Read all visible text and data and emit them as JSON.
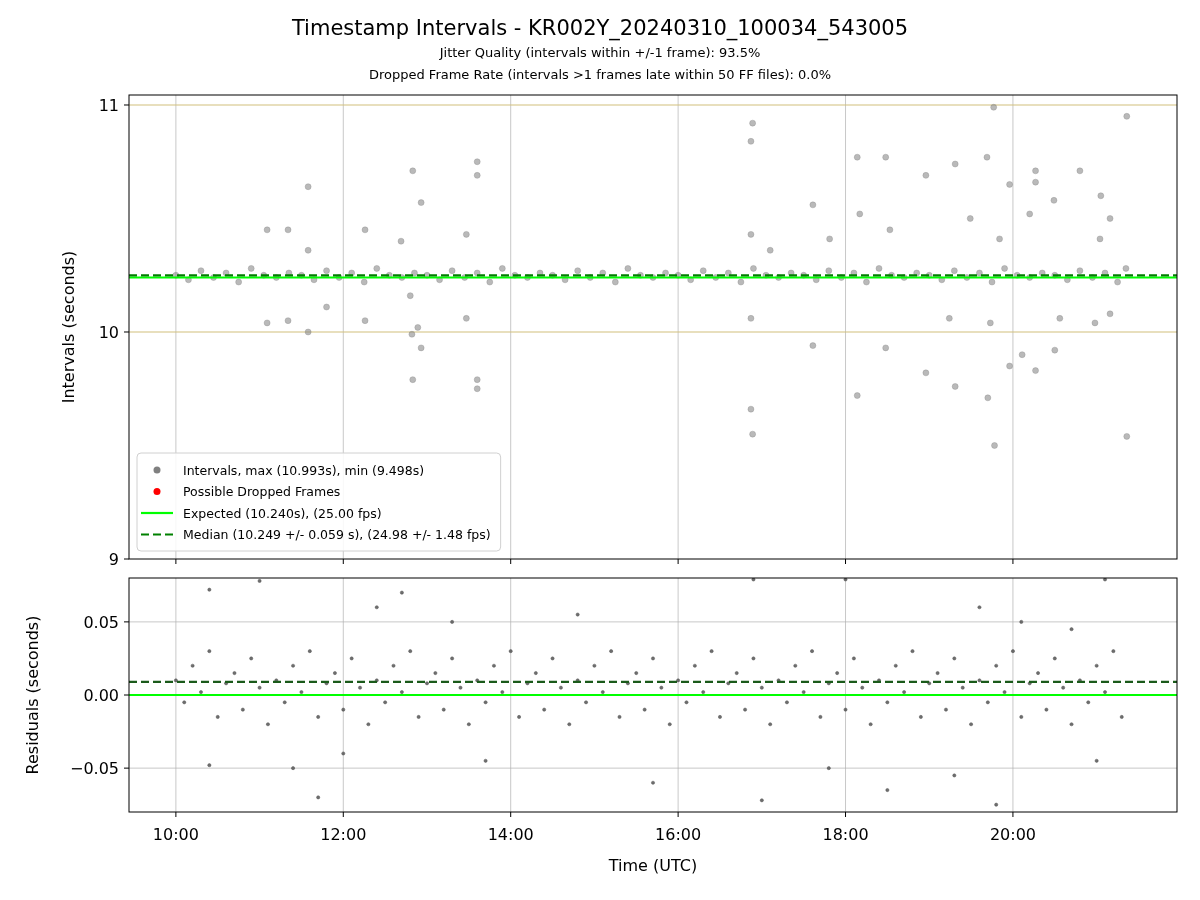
{
  "figure": {
    "title": "Timestamp Intervals - KR002Y_20240310_100034_543005",
    "subtitle_lines": [
      "Jitter Quality (intervals within +/-1 frame): 93.5%",
      "Dropped Frame Rate (intervals >1 frames late within 50 FF files): 0.0%"
    ]
  },
  "intervals_plot": {
    "chart_data": {
      "type": "scatter",
      "ylabel": "Intervals (seconds)",
      "xlim": [
        9.44,
        21.96
      ],
      "ylim": [
        9,
        11.044
      ],
      "yticks": [
        {
          "value": 9,
          "label": "9"
        },
        {
          "value": 10,
          "label": "10"
        },
        {
          "value": 11,
          "label": "11"
        }
      ],
      "ref_lines": [
        {
          "axis": "y",
          "value": 10
        },
        {
          "axis": "y",
          "value": 11
        }
      ],
      "grid": "x",
      "legend": true,
      "series": [
        {
          "name": "Intervals, max (10.993s), min (9.498s)",
          "color": "#808080",
          "x": [
            10,
            10.15,
            10.3,
            10.45,
            10.6,
            10.75,
            10.9,
            11.05,
            11.2,
            11.35,
            11.5,
            11.65,
            11.8,
            11.95,
            12.1,
            12.25,
            12.4,
            12.55,
            12.7,
            12.85,
            13,
            13.15,
            13.3,
            13.45,
            13.6,
            13.75,
            13.9,
            14.05,
            14.2,
            14.35,
            14.5,
            14.65,
            14.8,
            14.95,
            15.1,
            15.25,
            15.4,
            15.55,
            15.7,
            15.85,
            16,
            16.15,
            16.3,
            16.45,
            16.6,
            16.75,
            16.9,
            17.05,
            17.2,
            17.35,
            17.5,
            17.65,
            17.8,
            17.95,
            18.1,
            18.25,
            18.4,
            18.55,
            18.7,
            18.85,
            19,
            19.15,
            19.3,
            19.45,
            19.6,
            19.75,
            19.9,
            20.05,
            20.2,
            20.35,
            20.5,
            20.65,
            20.8,
            20.95,
            21.1,
            21.25,
            21.35,
            11.09,
            11.09,
            11.34,
            11.34,
            11.58,
            11.58,
            11.58,
            11.8,
            12.26,
            12.26,
            12.69,
            12.8,
            12.83,
            12.82,
            12.83,
            12.89,
            12.93,
            12.93,
            13.6,
            13.6,
            13.6,
            13.6,
            13.47,
            13.47,
            16.87,
            16.89,
            16.87,
            16.87,
            16.87,
            16.89,
            17.61,
            17.61,
            18.14,
            18.14,
            18.48,
            18.48,
            18.96,
            18.96,
            19.31,
            19.31,
            19.69,
            19.7,
            19.77,
            19.78,
            19.96,
            19.96,
            20.27,
            20.27,
            20.27,
            20.49,
            20.8,
            21.05,
            21.36,
            21.36,
            20.5,
            20.11,
            20.2,
            19.49,
            19.84,
            21.04,
            21.16,
            18.53,
            18.17,
            17.81,
            17.1,
            19.24,
            19.73,
            20.56,
            20.98,
            21.16
          ],
          "values": [
            10.25,
            10.23,
            10.27,
            10.24,
            10.26,
            10.22,
            10.28,
            10.25,
            10.24,
            10.26,
            10.25,
            10.23,
            10.27,
            10.24,
            10.26,
            10.22,
            10.28,
            10.25,
            10.24,
            10.26,
            10.25,
            10.23,
            10.27,
            10.24,
            10.26,
            10.22,
            10.28,
            10.25,
            10.24,
            10.26,
            10.25,
            10.23,
            10.27,
            10.24,
            10.26,
            10.22,
            10.28,
            10.25,
            10.24,
            10.26,
            10.25,
            10.23,
            10.27,
            10.24,
            10.26,
            10.22,
            10.28,
            10.25,
            10.24,
            10.26,
            10.25,
            10.23,
            10.27,
            10.24,
            10.26,
            10.22,
            10.28,
            10.25,
            10.24,
            10.26,
            10.25,
            10.23,
            10.27,
            10.24,
            10.26,
            10.22,
            10.28,
            10.25,
            10.24,
            10.26,
            10.25,
            10.23,
            10.27,
            10.24,
            10.26,
            10.22,
            10.28,
            10.45,
            10.04,
            10.45,
            10.05,
            10.64,
            10.36,
            10.0,
            10.11,
            10.45,
            10.05,
            10.4,
            10.16,
            10.71,
            9.99,
            9.79,
            10.02,
            9.93,
            10.57,
            10.75,
            10.69,
            9.79,
            9.75,
            10.06,
            10.43,
            10.84,
            10.92,
            10.43,
            10.06,
            9.66,
            9.55,
            10.56,
            9.94,
            10.77,
            9.72,
            10.77,
            9.93,
            10.69,
            9.82,
            10.74,
            9.76,
            10.77,
            9.71,
            10.99,
            9.5,
            10.65,
            9.85,
            10.71,
            10.66,
            9.83,
            10.58,
            10.71,
            10.6,
            10.95,
            9.54,
            9.92,
            9.9,
            10.52,
            10.5,
            10.41,
            10.41,
            10.5,
            10.45,
            10.52,
            10.41,
            10.36,
            10.06,
            10.04,
            10.06,
            10.04,
            10.08
          ]
        },
        {
          "name": "Possible Dropped Frames",
          "color": "#ff0000"
        },
        {
          "name": "Expected (10.240s), (25.00 fps)",
          "type": "line",
          "color": "#00ff00",
          "x": [
            9.44,
            21.96
          ],
          "values": [
            10.24,
            10.24
          ]
        },
        {
          "name": "Median (10.249 +/- 0.059 s), (24.98 +/- 1.48 fps)",
          "type": "line",
          "line_style": "dashed",
          "color": "#008000",
          "x": [
            9.44,
            21.96
          ],
          "values": [
            10.249,
            10.249
          ]
        }
      ]
    }
  },
  "residuals_plot": {
    "chart_data": {
      "type": "scatter",
      "xlabel": "Time (UTC)",
      "ylabel": "Residuals (seconds)",
      "grid": "both",
      "xlim": [
        9.44,
        21.96
      ],
      "ylim": [
        -0.08,
        0.08
      ],
      "xticks": [
        {
          "value": 10,
          "label": "10:00"
        },
        {
          "value": 12,
          "label": "12:00"
        },
        {
          "value": 14,
          "label": "14:00"
        },
        {
          "value": 16,
          "label": "16:00"
        },
        {
          "value": 18,
          "label": "18:00"
        },
        {
          "value": 20,
          "label": "20:00"
        }
      ],
      "yticks": [
        {
          "value": -0.05,
          "label": "−0.05"
        },
        {
          "value": 0,
          "label": "0.00"
        },
        {
          "value": 0.05,
          "label": "0.05"
        }
      ],
      "series": [
        {
          "color": "#555555",
          "x": [
            10,
            10.1,
            10.2,
            10.3,
            10.4,
            10.5,
            10.6,
            10.7,
            10.8,
            10.9,
            11,
            11.1,
            11.2,
            11.3,
            11.4,
            11.5,
            11.6,
            11.7,
            11.8,
            11.9,
            12,
            12.1,
            12.2,
            12.3,
            12.4,
            12.5,
            12.6,
            12.7,
            12.8,
            12.9,
            13,
            13.1,
            13.2,
            13.3,
            13.4,
            13.5,
            13.6,
            13.7,
            13.8,
            13.9,
            14,
            14.1,
            14.2,
            14.3,
            14.4,
            14.5,
            14.6,
            14.7,
            14.8,
            14.9,
            15,
            15.1,
            15.2,
            15.3,
            15.4,
            15.5,
            15.6,
            15.7,
            15.8,
            15.9,
            16,
            16.1,
            16.2,
            16.3,
            16.4,
            16.5,
            16.6,
            16.7,
            16.8,
            16.9,
            17,
            17.1,
            17.2,
            17.3,
            17.4,
            17.5,
            17.6,
            17.7,
            17.8,
            17.9,
            18,
            18.1,
            18.2,
            18.3,
            18.4,
            18.5,
            18.6,
            18.7,
            18.8,
            18.9,
            19,
            19.1,
            19.2,
            19.3,
            19.4,
            19.5,
            19.6,
            19.7,
            19.8,
            19.9,
            20,
            20.1,
            20.2,
            20.3,
            20.4,
            20.5,
            20.6,
            20.7,
            20.8,
            20.9,
            21,
            21.1,
            21.2,
            21.3,
            11,
            11.7,
            12.7,
            12,
            13.3,
            14.8,
            15.7,
            16.9,
            17,
            17.8,
            18,
            18.5,
            19.6,
            19.8,
            20.1,
            21.1,
            21,
            10.4,
            10.4,
            11.4,
            12.4,
            13.7,
            19.3,
            20.7
          ],
          "values": [
            0.01,
            -0.005,
            0.02,
            0.002,
            0.03,
            -0.015,
            0.008,
            0.015,
            -0.01,
            0.025,
            0.005,
            -0.02,
            0.01,
            -0.005,
            0.02,
            0.002,
            0.03,
            -0.015,
            0.008,
            0.015,
            -0.01,
            0.025,
            0.005,
            -0.02,
            0.01,
            -0.005,
            0.02,
            0.002,
            0.03,
            -0.015,
            0.008,
            0.015,
            -0.01,
            0.025,
            0.005,
            -0.02,
            0.01,
            -0.005,
            0.02,
            0.002,
            0.03,
            -0.015,
            0.008,
            0.015,
            -0.01,
            0.025,
            0.005,
            -0.02,
            0.01,
            -0.005,
            0.02,
            0.002,
            0.03,
            -0.015,
            0.008,
            0.015,
            -0.01,
            0.025,
            0.005,
            -0.02,
            0.01,
            -0.005,
            0.02,
            0.002,
            0.03,
            -0.015,
            0.008,
            0.015,
            -0.01,
            0.025,
            0.005,
            -0.02,
            0.01,
            -0.005,
            0.02,
            0.002,
            0.03,
            -0.015,
            0.008,
            0.015,
            -0.01,
            0.025,
            0.005,
            -0.02,
            0.01,
            -0.005,
            0.02,
            0.002,
            0.03,
            -0.015,
            0.008,
            0.015,
            -0.01,
            0.025,
            0.005,
            -0.02,
            0.01,
            -0.005,
            0.02,
            0.002,
            0.03,
            -0.015,
            0.008,
            0.015,
            -0.01,
            0.025,
            0.005,
            -0.02,
            0.01,
            -0.005,
            0.02,
            0.002,
            0.03,
            -0.015,
            0.078,
            -0.07,
            0.07,
            -0.04,
            0.05,
            0.055,
            -0.06,
            0.079,
            -0.072,
            -0.05,
            0.079,
            -0.065,
            0.06,
            -0.075,
            0.05,
            0.079,
            -0.045,
            0.072,
            -0.048,
            -0.05,
            0.06,
            -0.045,
            -0.055,
            0.045
          ]
        },
        {
          "type": "line",
          "color": "#00ff00",
          "x": [
            9.44,
            21.96
          ],
          "values": [
            0,
            0
          ]
        },
        {
          "type": "line",
          "line_style": "dashed",
          "color": "#1a5a1a",
          "x": [
            9.44,
            21.96
          ],
          "values": [
            0.009,
            0.009
          ]
        }
      ]
    }
  }
}
